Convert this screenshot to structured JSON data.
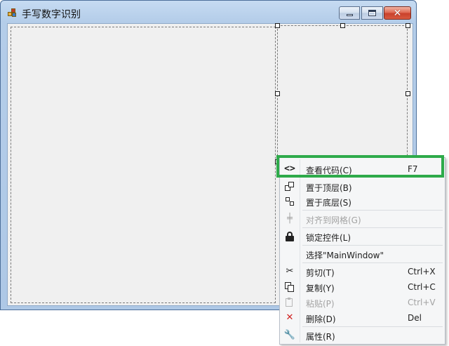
{
  "window": {
    "title": "手写数字识别",
    "controls": {
      "minimize": "minimize",
      "maximize": "maximize",
      "close": "close"
    }
  },
  "context_menu": {
    "items": [
      {
        "label": "查看代码(C)",
        "shortcut": "F7",
        "icon": "code-icon",
        "enabled": true,
        "highlighted": true
      },
      {
        "label": "置于顶层(B)",
        "shortcut": "",
        "icon": "bring-to-front-icon",
        "enabled": true
      },
      {
        "label": "置于底层(S)",
        "shortcut": "",
        "icon": "send-to-back-icon",
        "enabled": true
      },
      {
        "label": "对齐到网格(G)",
        "shortcut": "",
        "icon": "align-to-grid-icon",
        "enabled": false
      },
      {
        "label": "锁定控件(L)",
        "shortcut": "",
        "icon": "lock-icon",
        "enabled": true
      },
      {
        "label": "选择\"MainWindow\"",
        "shortcut": "",
        "icon": "",
        "enabled": true
      },
      {
        "label": "剪切(T)",
        "shortcut": "Ctrl+X",
        "icon": "cut-icon",
        "enabled": true
      },
      {
        "label": "复制(Y)",
        "shortcut": "Ctrl+C",
        "icon": "copy-icon",
        "enabled": true
      },
      {
        "label": "粘贴(P)",
        "shortcut": "Ctrl+V",
        "icon": "paste-icon",
        "enabled": false
      },
      {
        "label": "删除(D)",
        "shortcut": "Del",
        "icon": "delete-icon",
        "enabled": true
      },
      {
        "label": "属性(R)",
        "shortcut": "",
        "icon": "properties-icon",
        "enabled": true
      }
    ]
  },
  "colors": {
    "highlight_border": "#2eaa4a",
    "delete_icon": "#d01f1f",
    "disabled_text": "#a3a3a3"
  }
}
